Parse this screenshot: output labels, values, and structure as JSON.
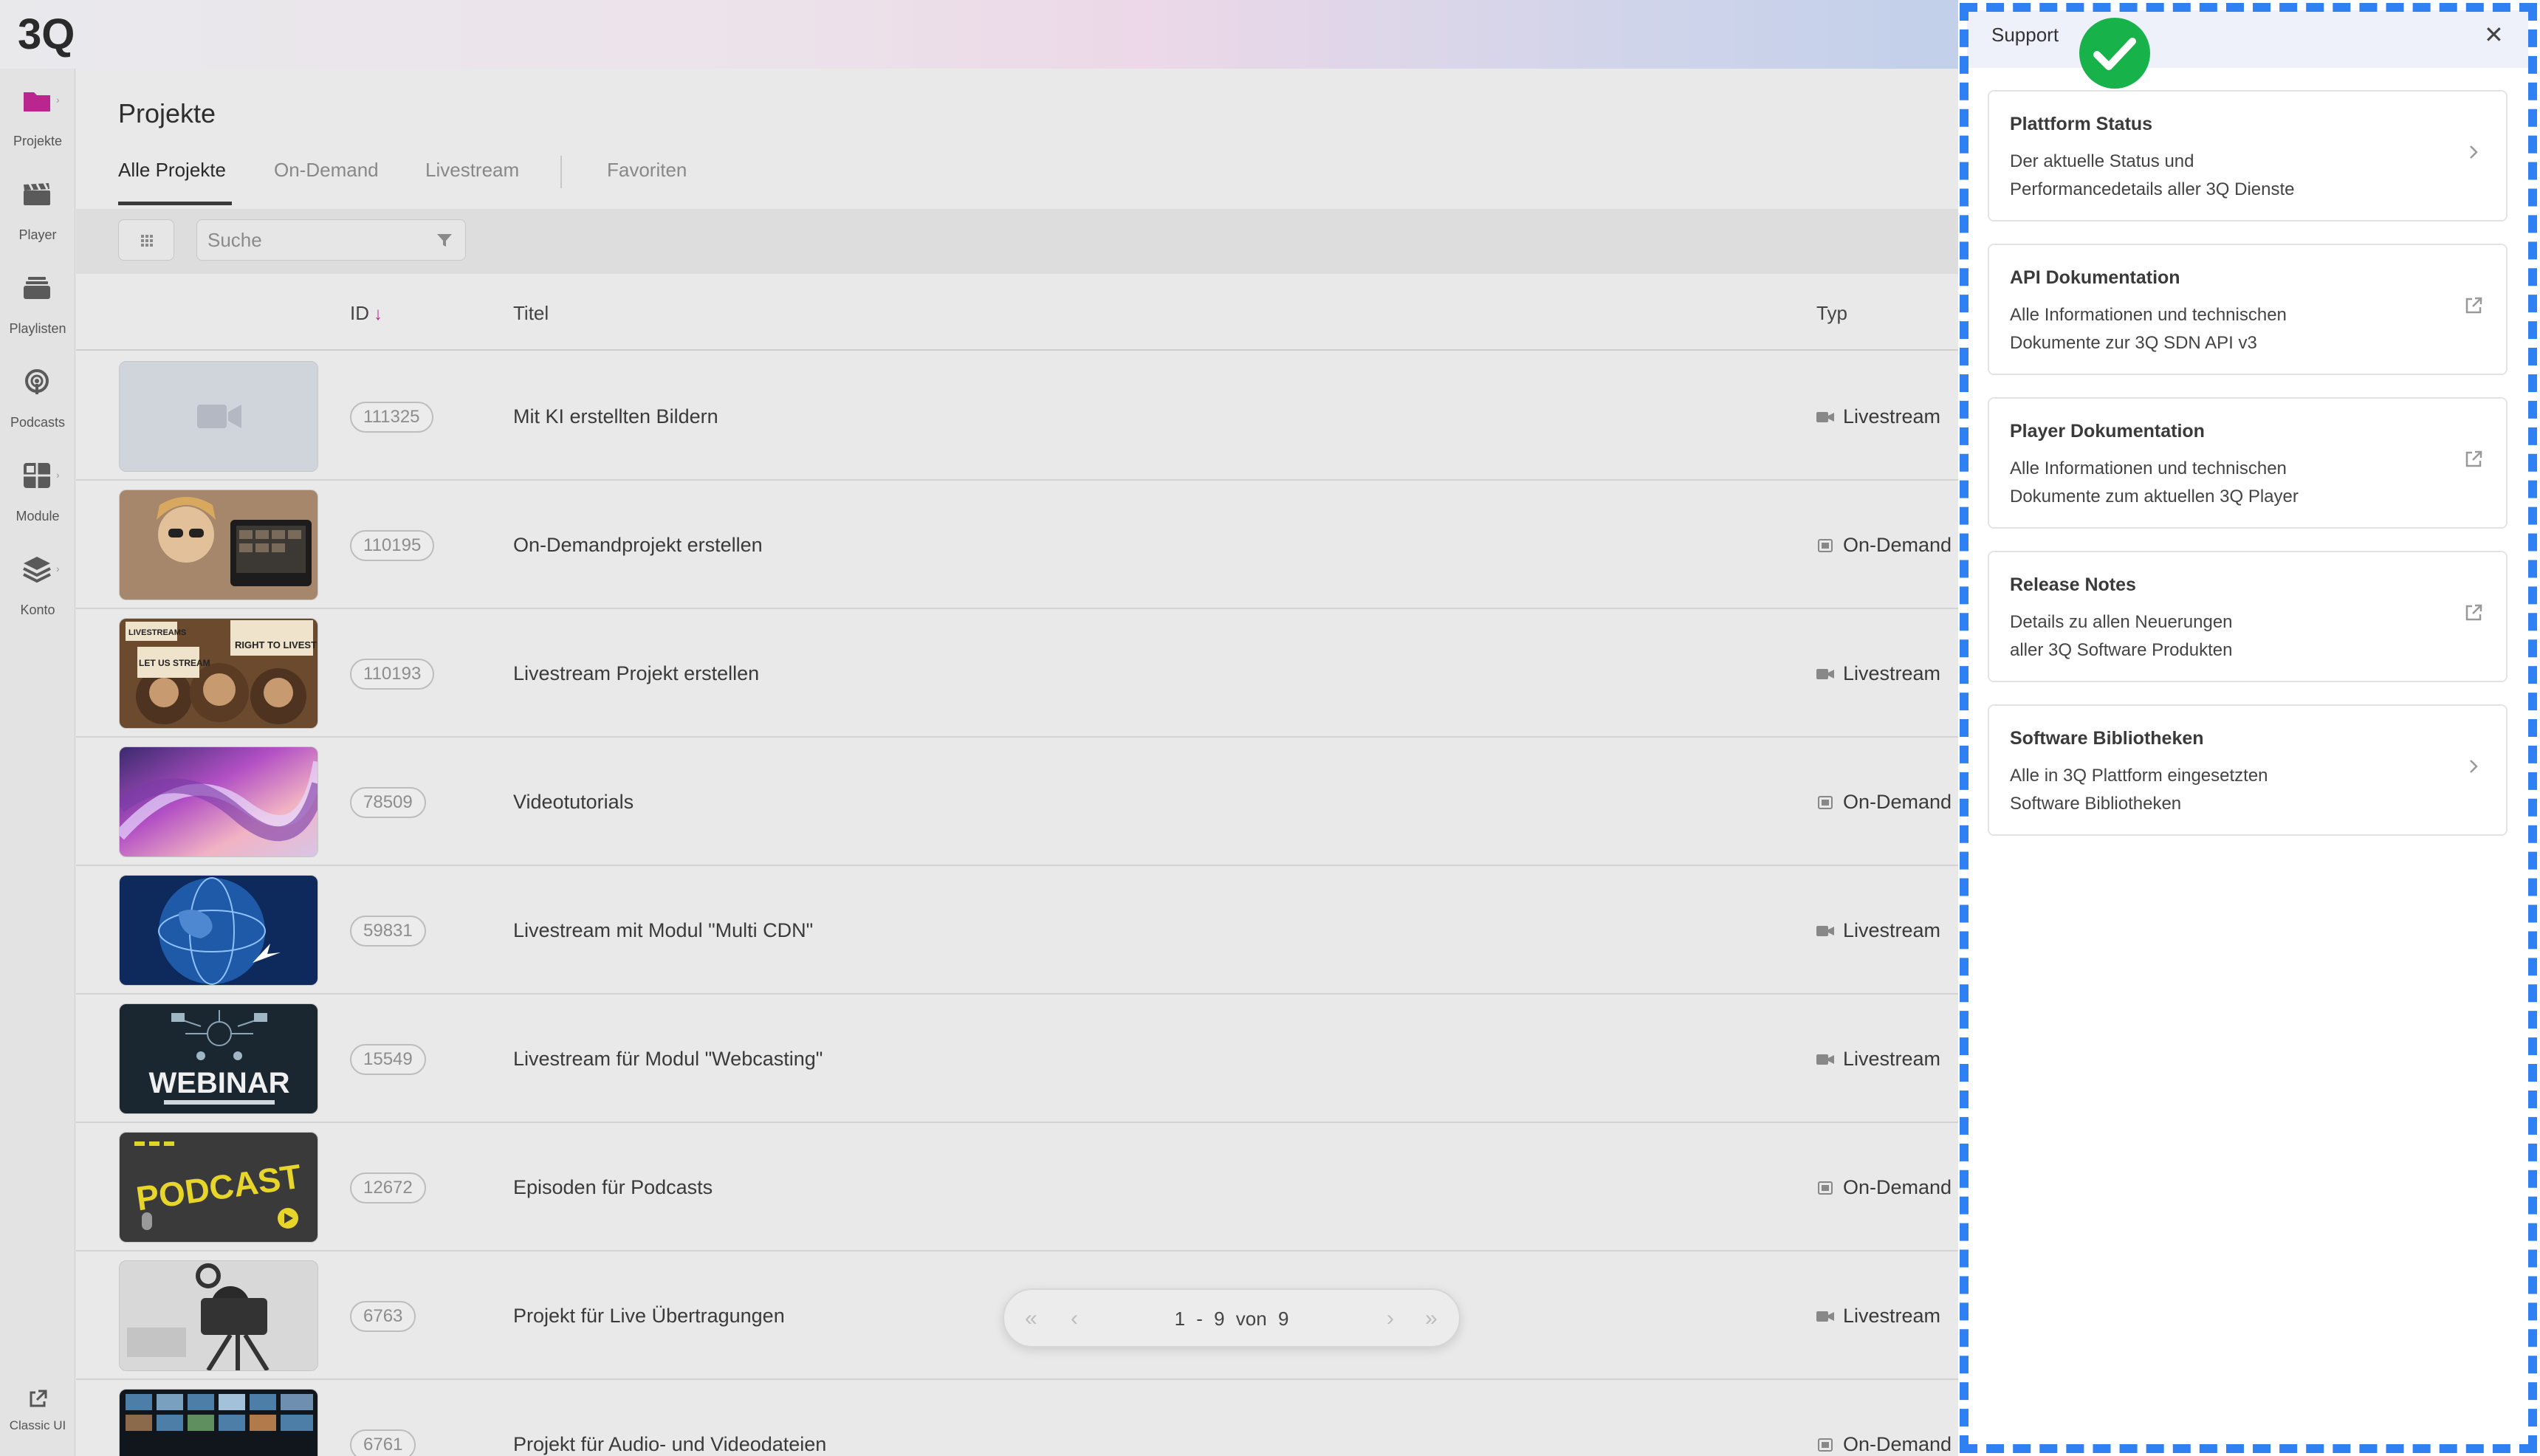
{
  "app": {
    "logo_text": "3Q"
  },
  "sidebar": {
    "items": [
      {
        "label": "Projekte",
        "icon": "folder-icon",
        "active": true
      },
      {
        "label": "Player",
        "icon": "clapperboard-icon"
      },
      {
        "label": "Playlisten",
        "icon": "stack-icon"
      },
      {
        "label": "Podcasts",
        "icon": "podcast-icon"
      },
      {
        "label": "Module",
        "icon": "grid-icon"
      },
      {
        "label": "Konto",
        "icon": "layers-icon"
      }
    ],
    "classic_label": "Classic UI"
  },
  "main": {
    "title": "Projekte",
    "tabs": [
      {
        "label": "Alle Projekte",
        "active": true
      },
      {
        "label": "On-Demand"
      },
      {
        "label": "Livestream"
      },
      {
        "label": "Favoriten"
      }
    ],
    "search": {
      "placeholder": "Suche"
    },
    "columns": {
      "id": "ID",
      "title": "Titel",
      "type": "Typ"
    },
    "rows": [
      {
        "id": "111325",
        "title": "Mit KI erstellten Bildern",
        "type": "Livestream",
        "thumb": "placeholder"
      },
      {
        "id": "110195",
        "title": "On-Demandprojekt erstellen",
        "type": "On-Demand",
        "thumb": "woman-laptop"
      },
      {
        "id": "110193",
        "title": "Livestream Projekt erstellen",
        "type": "Livestream",
        "thumb": "monkeys"
      },
      {
        "id": "78509",
        "title": "Videotutorials",
        "type": "On-Demand",
        "thumb": "abstract"
      },
      {
        "id": "59831",
        "title": "Livestream mit Modul \"Multi CDN\"",
        "type": "Livestream",
        "thumb": "globe"
      },
      {
        "id": "15549",
        "title": "Livestream für Modul \"Webcasting\"",
        "type": "Livestream",
        "thumb": "webinar"
      },
      {
        "id": "12672",
        "title": "Episoden für Podcasts",
        "type": "On-Demand",
        "thumb": "podcast"
      },
      {
        "id": "6763",
        "title": "Projekt für Live Übertragungen",
        "type": "Livestream",
        "thumb": "camera"
      },
      {
        "id": "6761",
        "title": "Projekt für Audio- und Videodateien",
        "type": "On-Demand",
        "thumb": "screens"
      }
    ],
    "thumb_text": {
      "monkey_sign_1": "LIVESTREAMS",
      "monkey_sign_2": "RIGHT TO LIVESTREAM",
      "monkey_sign_3": "LET US STREAM",
      "webinar": "WEBINAR",
      "podcast": "PODCAST"
    },
    "pagination": {
      "text": "1 - 9 von 9"
    }
  },
  "support": {
    "title": "Support",
    "close": "✕",
    "cards": [
      {
        "title": "Plattform Status",
        "desc_1": "Der aktuelle Status und",
        "desc_2": "Performancedetails aller 3Q Dienste",
        "icon": "chevron-right-icon"
      },
      {
        "title": "API Dokumentation",
        "desc_1": "Alle Informationen und technischen",
        "desc_2": "Dokumente zur 3Q SDN API v3",
        "icon": "external-link-icon"
      },
      {
        "title": "Player Dokumentation",
        "desc_1": "Alle Informationen und technischen",
        "desc_2": "Dokumente zum aktuellen 3Q Player",
        "icon": "external-link-icon"
      },
      {
        "title": "Release Notes",
        "desc_1": "Details zu allen Neuerungen",
        "desc_2": "aller 3Q Software Produkten",
        "icon": "external-link-icon"
      },
      {
        "title": "Software Bibliotheken",
        "desc_1": "Alle in 3Q Plattform eingesetzten",
        "desc_2": "Software Bibliotheken",
        "icon": "chevron-right-icon"
      }
    ]
  },
  "colors": {
    "accent": "#b9278e",
    "highlight_border": "#2f80f3",
    "check_green": "#17b34a"
  }
}
